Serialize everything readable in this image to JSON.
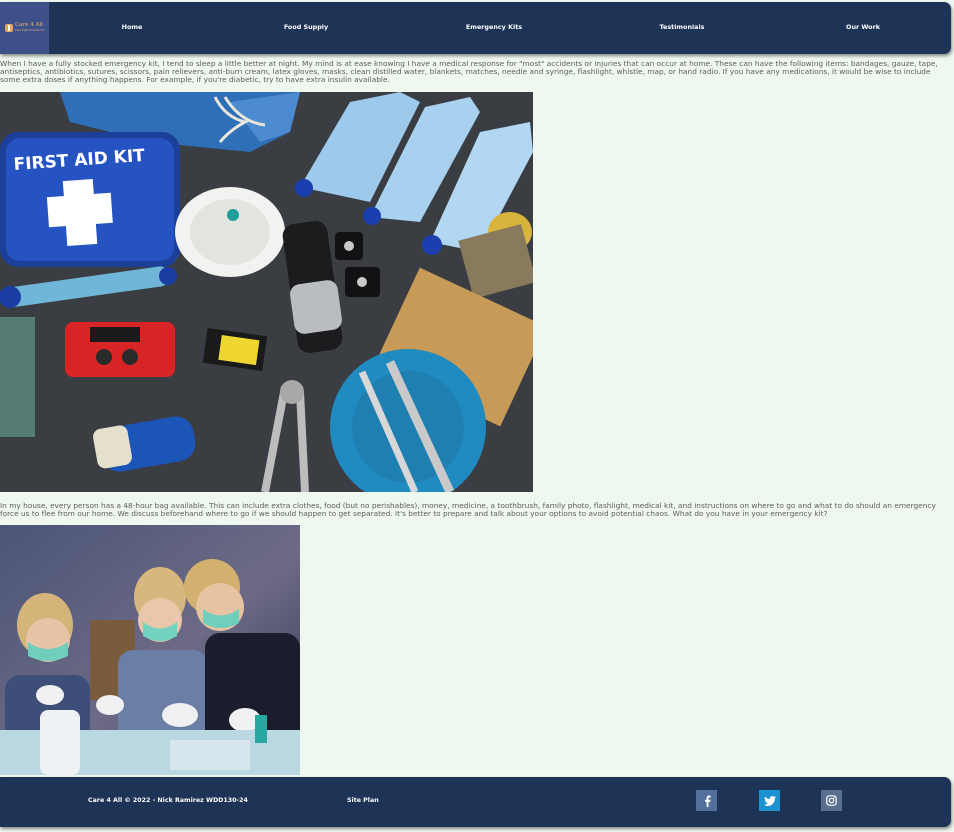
{
  "header": {
    "logo": {
      "title": "Care 4 All",
      "subtitle": "Care Fight Hospital Kit"
    },
    "nav": [
      {
        "label": "Home"
      },
      {
        "label": "Food Supply"
      },
      {
        "label": "Emergency Kits"
      },
      {
        "label": "Testimonials"
      },
      {
        "label": "Our Work"
      }
    ]
  },
  "main": {
    "paragraph_1": "When I have a fully stocked emergency kit, I tend to sleep a little better at night. My mind is at ease knowing I have a medical response for \"most\" accidents or injuries that can occur at home. These can have the following items: bandages, gauze, tape, antiseptics, antibiotics, sutures, scissors, pain relievers, anti-burn cream, latex gloves, masks, clean distilled water, blankets, matches, needle and syringe, flashlight, whistle, map, or hand radio. If you have any medications, it would be wise to include some extra doses if anything happens. For example, if you're diabetic, try to have extra insulin available.",
    "image_1": {
      "kit_label": "FIRST AID KIT",
      "icon": "first-aid-kit-photo"
    },
    "paragraph_2": "In my house, every person has a 48-hour bag available. This can include extra clothes, food (but no perishables), money, medicine, a toothbrush, family photo, flashlight, medical kit, and instructions on where to go and what to do should an emergency force us to flee from our home. We discuss beforehand where to go if we should happen to get separated. It's better to prepare and talk about your options to avoid potential chaos. What do you have in your emergency kit?",
    "image_2": {
      "icon": "children-with-masks-photo"
    }
  },
  "footer": {
    "copyright": "Care 4 All © 2022 - Nick Ramirez WDD130-24",
    "site_plan": "Site Plan",
    "social": [
      {
        "icon": "facebook-icon",
        "color": "#52709b"
      },
      {
        "icon": "twitter-icon",
        "color": "#1d92d1"
      },
      {
        "icon": "instagram-icon",
        "color": "#5a6e8e"
      }
    ]
  },
  "colors": {
    "background": "#eff8ee",
    "navy": "#1e3456",
    "logo_bg": "#3d5089",
    "body_text": "#5d5d5d"
  }
}
